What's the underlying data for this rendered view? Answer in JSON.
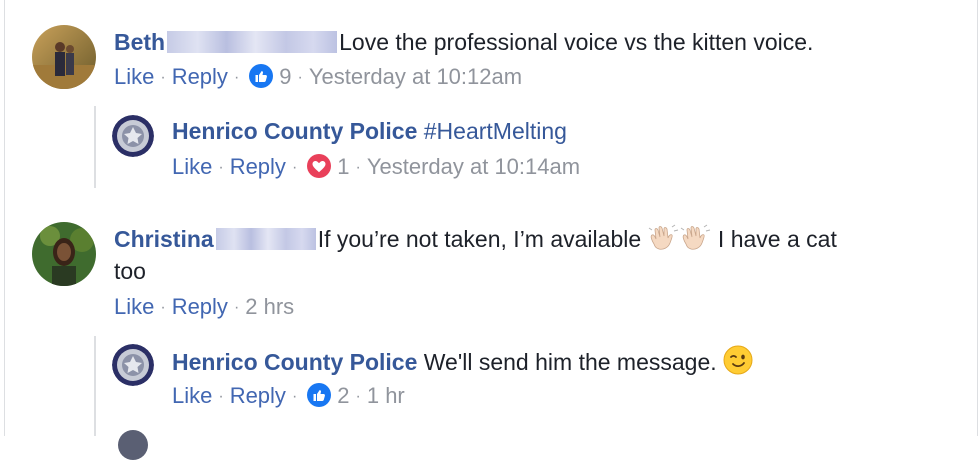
{
  "comments": [
    {
      "author": "Beth",
      "text": "Love the professional voice vs the kitten voice.",
      "like": "Like",
      "reply": "Reply",
      "reaction_count": "9",
      "time": "Yesterday at 10:12am",
      "reaction": "like-reaction-icon",
      "reply_item": {
        "author": "Henrico County Police",
        "text": "#HeartMelting",
        "like": "Like",
        "reply": "Reply",
        "reaction_count": "1",
        "time": "Yesterday at 10:14am",
        "reaction": "love-reaction-icon"
      }
    },
    {
      "author": "Christina",
      "text_line1": "If you’re not taken, I’m available",
      "text_after_emoji": "I have a cat",
      "text_line2": "too",
      "like": "Like",
      "reply": "Reply",
      "time": "2 hrs",
      "reply_item": {
        "author": "Henrico County Police",
        "text": "We'll send him the message.",
        "like": "Like",
        "reply": "Reply",
        "reaction_count": "2",
        "time": "1 hr",
        "reaction": "like-reaction-icon"
      }
    }
  ],
  "colors": {
    "link": "#365899",
    "action": "#4267b2",
    "meta": "#90949c",
    "like": "#1877f2",
    "love": "#e9405a"
  }
}
